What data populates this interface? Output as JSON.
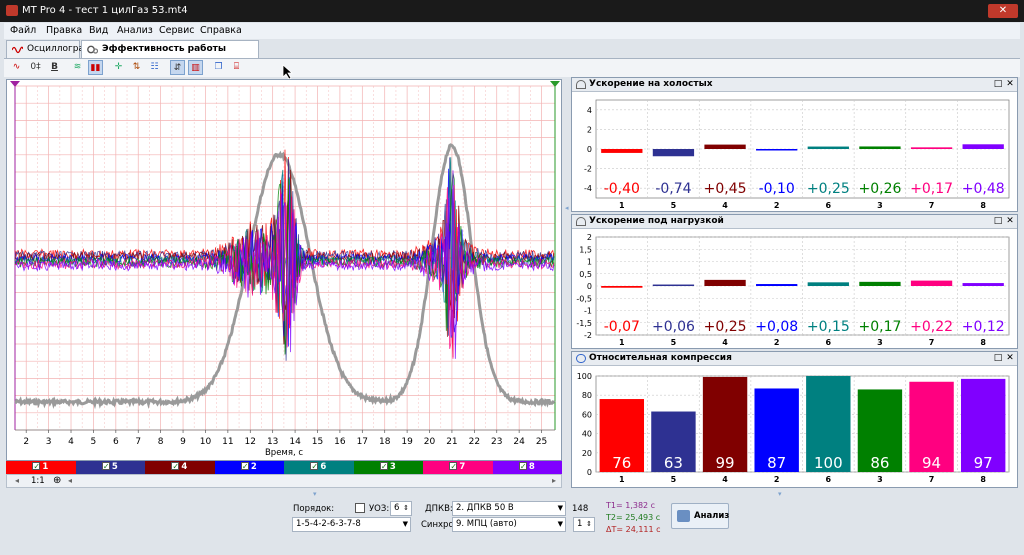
{
  "window": {
    "title": "MT Pro 4 - тест 1 цилГаз 53.mt4",
    "close_label": "✕"
  },
  "menu": [
    "Файл",
    "Правка",
    "Вид",
    "Анализ",
    "Сервис",
    "Справка"
  ],
  "tabs": [
    {
      "label": "Осциллограф",
      "active": false
    },
    {
      "label": "Эффективность работы цилиндров",
      "active": true
    }
  ],
  "toolbar": {
    "bold_label": "B"
  },
  "oscillogram": {
    "x_axis_label": "Время, с",
    "x_ticks": [
      "2",
      "3",
      "4",
      "5",
      "6",
      "7",
      "8",
      "9",
      "10",
      "11",
      "12",
      "13",
      "14",
      "15",
      "16",
      "17",
      "18",
      "19",
      "20",
      "21",
      "22",
      "23",
      "24",
      "25"
    ],
    "x_range": [
      1.5,
      25.6
    ]
  },
  "cylinders": [
    {
      "num": "1",
      "color": "#ff0000"
    },
    {
      "num": "5",
      "color": "#2e3192"
    },
    {
      "num": "4",
      "color": "#800000"
    },
    {
      "num": "2",
      "color": "#0000ff"
    },
    {
      "num": "6",
      "color": "#008080"
    },
    {
      "num": "3",
      "color": "#008000"
    },
    {
      "num": "7",
      "color": "#ff0080"
    },
    {
      "num": "8",
      "color": "#8000ff"
    }
  ],
  "scroll": {
    "zoom_label": "1:1"
  },
  "panels": {
    "idle": {
      "title": "Ускорение на холостых",
      "chart_data": {
        "type": "bar",
        "title": "Ускорение на холостых",
        "categories": [
          "1",
          "5",
          "4",
          "2",
          "6",
          "3",
          "7",
          "8"
        ],
        "values": [
          -0.4,
          -0.74,
          0.45,
          -0.1,
          0.25,
          0.26,
          0.17,
          0.48
        ],
        "labels": [
          "-0,40",
          "-0,74",
          "+0,45",
          "-0,10",
          "+0,25",
          "+0,26",
          "+0,17",
          "+0,48"
        ],
        "ylim": [
          -5,
          5
        ],
        "yticks": [
          "4",
          "2",
          "0",
          "-2",
          "-4"
        ],
        "ytick_values": [
          4,
          2,
          0,
          -2,
          -4
        ],
        "grid": true
      }
    },
    "load": {
      "title": "Ускорение под нагрузкой",
      "chart_data": {
        "type": "bar",
        "title": "Ускорение под нагрузкой",
        "categories": [
          "1",
          "5",
          "4",
          "2",
          "6",
          "3",
          "7",
          "8"
        ],
        "values": [
          -0.07,
          0.06,
          0.25,
          0.08,
          0.15,
          0.17,
          0.22,
          0.12
        ],
        "labels": [
          "-0,07",
          "+0,06",
          "+0,25",
          "+0,08",
          "+0,15",
          "+0,17",
          "+0,22",
          "+0,12"
        ],
        "ylim": [
          -2,
          2
        ],
        "yticks": [
          "2",
          "1,5",
          "1",
          "0,5",
          "0",
          "-0,5",
          "-1",
          "-1,5",
          "-2"
        ],
        "ytick_values": [
          2,
          1.5,
          1,
          0.5,
          0,
          -0.5,
          -1,
          -1.5,
          -2
        ],
        "grid": true
      }
    },
    "compression": {
      "title": "Относительная компрессия",
      "chart_data": {
        "type": "bar",
        "title": "Относительная компрессия",
        "categories": [
          "1",
          "5",
          "4",
          "2",
          "6",
          "3",
          "7",
          "8"
        ],
        "values": [
          76,
          63,
          99,
          87,
          100,
          86,
          94,
          97
        ],
        "labels": [
          "76",
          "63",
          "99",
          "87",
          "100",
          "86",
          "94",
          "97"
        ],
        "ylim": [
          0,
          100
        ],
        "yticks": [
          "100",
          "80",
          "60",
          "40",
          "20",
          "0"
        ],
        "ytick_values": [
          100,
          80,
          60,
          40,
          20,
          0
        ],
        "grid": true
      }
    }
  },
  "bottom": {
    "order_label": "Порядок:",
    "order_value": "1-5-4-2-6-3-7-8",
    "uoz_label": "УОЗ:",
    "uoz_value": "6",
    "dpkv_label": "ДПКВ:",
    "dpkv_value": "2. ДПКВ 50 В",
    "rpm_value": "148",
    "sync_label": "Синхро:",
    "sync_value": "9. МПЦ (авто)",
    "sync_num": "1",
    "t1": "T1= 1,382 с",
    "t2": "T2= 25,493 с",
    "dt": "ΔT= 24,111 с",
    "analyze_label": "Анализ"
  }
}
